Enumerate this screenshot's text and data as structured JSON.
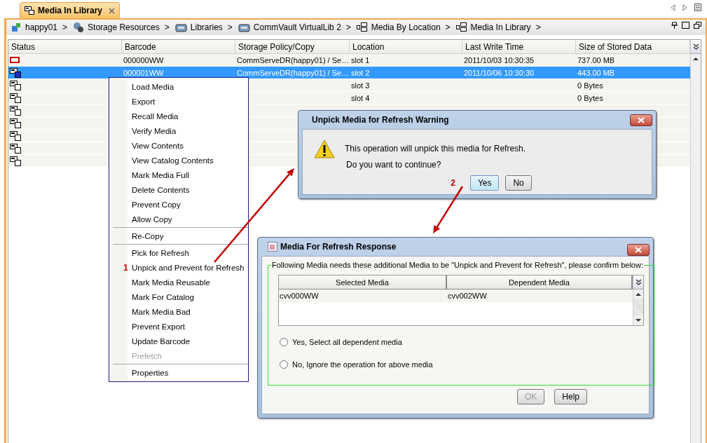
{
  "tab": {
    "label": "Media In Library",
    "selected": true
  },
  "breadcrumbs": [
    {
      "label": "happy01",
      "after": ">"
    },
    {
      "label": "Storage Resources",
      "after": ">"
    },
    {
      "label": "Libraries",
      "after": ">"
    },
    {
      "label": "CommVault VirtualLib 2",
      "after": ">"
    },
    {
      "label": "Media By Location",
      "after": ">"
    },
    {
      "label": "Media In Library",
      "after": ">"
    }
  ],
  "table": {
    "columns": [
      "Status",
      "Barcode",
      "Storage Policy/Copy",
      "Location",
      "Last Write Time",
      "Size of Stored Data"
    ],
    "rows": [
      {
        "kind": "error",
        "selected": false,
        "cells": [
          "000000WW",
          "CommServeDR(happy01) / Se…",
          "slot 1",
          "2011/10/03 10:30:35",
          "737.00 MB"
        ]
      },
      {
        "kind": "normal",
        "selected": true,
        "cells": [
          "000001WW",
          "CommServeDR(happy01) / Se…",
          "slot 2",
          "2011/10/06 10:30:30",
          "443.00 MB"
        ]
      },
      {
        "kind": "normal",
        "selected": false,
        "cells": [
          "",
          "",
          "slot 3",
          "",
          "0 Bytes"
        ]
      },
      {
        "kind": "normal",
        "selected": false,
        "cells": [
          "",
          "",
          "slot 4",
          "",
          "0 Bytes"
        ]
      },
      {
        "kind": "normal",
        "selected": false
      },
      {
        "kind": "normal",
        "selected": false
      },
      {
        "kind": "normal",
        "selected": false
      },
      {
        "kind": "normal",
        "selected": false
      },
      {
        "kind": "normal",
        "selected": false
      }
    ]
  },
  "context_menu": {
    "items": [
      {
        "kind": "item",
        "label": "Load Media",
        "disabled": false
      },
      {
        "kind": "item",
        "label": "Export",
        "disabled": false
      },
      {
        "kind": "item",
        "label": "Recall Media",
        "disabled": false
      },
      {
        "kind": "item",
        "label": "Verify Media",
        "disabled": false
      },
      {
        "kind": "item",
        "label": "View Contents",
        "disabled": false
      },
      {
        "kind": "item",
        "label": "View Catalog Contents",
        "disabled": false
      },
      {
        "kind": "item",
        "label": "Mark Media Full",
        "disabled": false
      },
      {
        "kind": "item",
        "label": "Delete Contents",
        "disabled": false
      },
      {
        "kind": "item",
        "label": "Prevent Copy",
        "disabled": false
      },
      {
        "kind": "item",
        "label": "Allow Copy",
        "disabled": false
      },
      {
        "kind": "separator"
      },
      {
        "kind": "item",
        "label": "Re-Copy",
        "disabled": false
      },
      {
        "kind": "separator"
      },
      {
        "kind": "item",
        "label": "Pick for Refresh",
        "disabled": false
      },
      {
        "kind": "item",
        "label": "Unpick and Prevent for Refresh",
        "disabled": false,
        "marker": "1"
      },
      {
        "kind": "item",
        "label": "Mark Media Reusable",
        "disabled": false
      },
      {
        "kind": "item",
        "label": "Mark For Catalog",
        "disabled": false
      },
      {
        "kind": "item",
        "label": "Mark Media Bad",
        "disabled": false
      },
      {
        "kind": "item",
        "label": "Prevent Export",
        "disabled": false
      },
      {
        "kind": "item",
        "label": "Update Barcode",
        "disabled": false
      },
      {
        "kind": "item",
        "label": "Prefetch",
        "disabled": true
      },
      {
        "kind": "separator"
      },
      {
        "kind": "item",
        "label": "Properties",
        "disabled": false
      }
    ]
  },
  "warning_dialog": {
    "title": "Unpick Media for Refresh Warning",
    "message": "This operation will unpick this media for Refresh.",
    "question": "Do you want to continue?",
    "marker": "2",
    "buttons": [
      {
        "label": "Yes",
        "focused": true
      },
      {
        "label": "No",
        "focused": false
      }
    ]
  },
  "response_dialog": {
    "title": "Media For Refresh Response",
    "group_label": "Following Media needs these additional Media to be \"Unpick and Prevent for Refresh\", please confirm below:",
    "columns": [
      "Selected Media",
      "Dependent Media"
    ],
    "rows": [
      [
        "cvv000WW",
        "cvv002WW"
      ]
    ],
    "options": [
      {
        "label": "Yes, Select all dependent media",
        "selected": false
      },
      {
        "label": "No, Ignore the operation for above media",
        "selected": false
      }
    ],
    "buttons": [
      {
        "label": "OK",
        "disabled": true
      },
      {
        "label": "Help",
        "disabled": false
      }
    ]
  }
}
